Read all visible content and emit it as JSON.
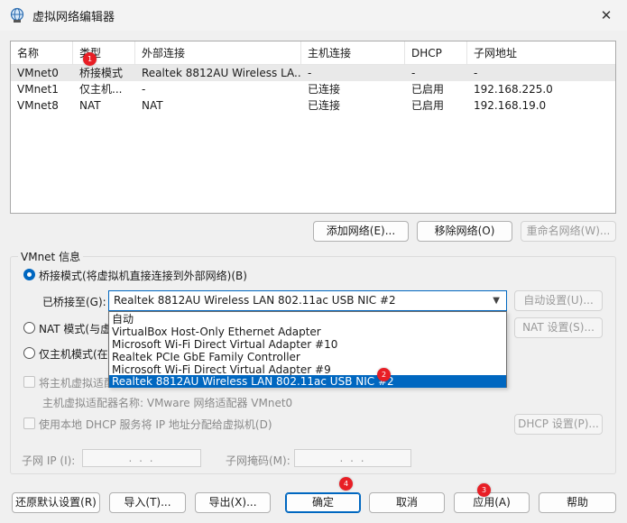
{
  "window": {
    "title": "虚拟网络编辑器",
    "close_glyph": "✕",
    "icon": "network-globe-icon"
  },
  "table": {
    "headers": [
      "名称",
      "类型",
      "外部连接",
      "主机连接",
      "DHCP",
      "子网地址"
    ],
    "rows": [
      {
        "name": "VMnet0",
        "type": "桥接模式",
        "external": "Realtek 8812AU Wireless LA...",
        "host": "-",
        "dhcp": "-",
        "subnet": "-"
      },
      {
        "name": "VMnet1",
        "type": "仅主机...",
        "external": "-",
        "host": "已连接",
        "dhcp": "已启用",
        "subnet": "192.168.225.0"
      },
      {
        "name": "VMnet8",
        "type": "NAT",
        "external": "NAT",
        "host": "已连接",
        "dhcp": "已启用",
        "subnet": "192.168.19.0"
      }
    ],
    "selected_row": 0
  },
  "list_buttons": {
    "add": "添加网络(E)...",
    "remove": "移除网络(O)",
    "rename": "重命名网络(W)..."
  },
  "vmnet_info": {
    "group_label": "VMnet 信息",
    "bridged_label": "桥接模式(将虚拟机直接连接到外部网络)(B)",
    "bridged_to_label": "已桥接至(G):",
    "bridged_to_value": "Realtek 8812AU Wireless LAN 802.11ac USB NIC #2",
    "auto_settings": "自动设置(U)...",
    "nat_label": "NAT 模式(与虚",
    "nat_settings": "NAT 设置(S)...",
    "host_only_label": "仅主机模式(在专",
    "connect_adapter_label": "将主机虚拟适配",
    "adapter_name_label": "主机虚拟适配器名称: VMware 网络适配器 VMnet0",
    "dhcp_label": "使用本地 DHCP 服务将 IP 地址分配给虚拟机(D)",
    "dhcp_settings": "DHCP 设置(P)...",
    "subnet_ip_label": "子网 IP (I):",
    "subnet_ip_value": ".    .    .",
    "subnet_mask_label": "子网掩码(M):",
    "subnet_mask_value": ".    .    .",
    "mode": "bridged"
  },
  "dropdown": {
    "options": [
      "自动",
      "VirtualBox Host-Only Ethernet Adapter",
      "Microsoft Wi-Fi Direct Virtual Adapter #10",
      "Realtek PCIe GbE Family Controller",
      "Microsoft Wi-Fi Direct Virtual Adapter #9",
      "Realtek 8812AU Wireless LAN 802.11ac USB NIC #2"
    ],
    "selected_index": 5
  },
  "footer_buttons": {
    "restore": "还原默认设置(R)",
    "import": "导入(T)...",
    "export": "导出(X)...",
    "ok": "确定",
    "cancel": "取消",
    "apply": "应用(A)",
    "help": "帮助"
  },
  "annotations": [
    "1",
    "2",
    "3",
    "4"
  ],
  "colors": {
    "accent": "#0067c0",
    "badge": "#e81e25",
    "window_bg": "#f0f0f0"
  }
}
